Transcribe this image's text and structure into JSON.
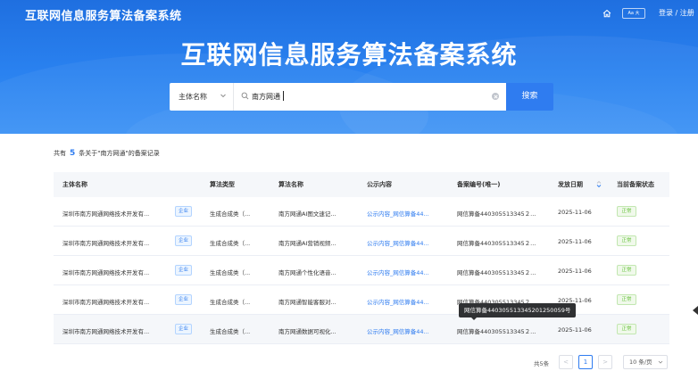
{
  "header": {
    "brand": "互联网信息服务算法备案系统",
    "font_toggle": "Aa 大",
    "login": "登录 / 注册"
  },
  "hero": {
    "title": "互联网信息服务算法备案系统"
  },
  "search": {
    "field_select": "主体名称",
    "value": "南方网通",
    "button": "搜索"
  },
  "summary": {
    "prefix": "共有",
    "count": "5",
    "suffix": "条关于\"南方网通\"的备案记录"
  },
  "table": {
    "headers": [
      "主体名称",
      "算法类型",
      "算法名称",
      "公示内容",
      "备案编号(唯一)",
      "发放日期",
      "当前备案状态"
    ],
    "rows": [
      {
        "entity": "深圳市南方网通网络技术开发有...",
        "tag": "企业",
        "type": "生成合成类（...",
        "name": "南方网通AI图文速记...",
        "content": "公示内容_网信算备44...",
        "code": "网信算备440305513345２...",
        "date": "2025-11-06",
        "status": "正常"
      },
      {
        "entity": "深圳市南方网通网络技术开发有...",
        "tag": "企业",
        "type": "生成合成类（...",
        "name": "南方网通AI营销视频...",
        "content": "公示内容_网信算备44...",
        "code": "网信算备440305513345２...",
        "date": "2025-11-06",
        "status": "正常"
      },
      {
        "entity": "深圳市南方网通网络技术开发有...",
        "tag": "企业",
        "type": "生成合成类（...",
        "name": "南方网通个性化语音...",
        "content": "公示内容_网信算备44...",
        "code": "网信算备440305513345２...",
        "date": "2025-11-06",
        "status": "正常"
      },
      {
        "entity": "深圳市南方网通网络技术开发有...",
        "tag": "企业",
        "type": "生成合成类（...",
        "name": "南方网通智能客服对...",
        "content": "公示内容_网信算备44...",
        "code": "网信算备440305513345２...",
        "date": "2025-11-06",
        "status": "正常"
      },
      {
        "entity": "深圳市南方网通网络技术开发有...",
        "tag": "企业",
        "type": "生成合成类（...",
        "name": "南方网通数据可视化...",
        "content": "公示内容_网信算备44...",
        "code": "网信算备440305513345２...",
        "date": "2025-11-06",
        "status": "正常"
      }
    ]
  },
  "tooltip": "网信算备440305513345201250059号",
  "pagination": {
    "total": "共5条",
    "prev": "<",
    "current": "1",
    "next": ">",
    "page_size": "10 条/页"
  },
  "colors": {
    "primary": "#2f7cf0",
    "hero_top": "#1f6fe0",
    "success": "#67c23a"
  }
}
